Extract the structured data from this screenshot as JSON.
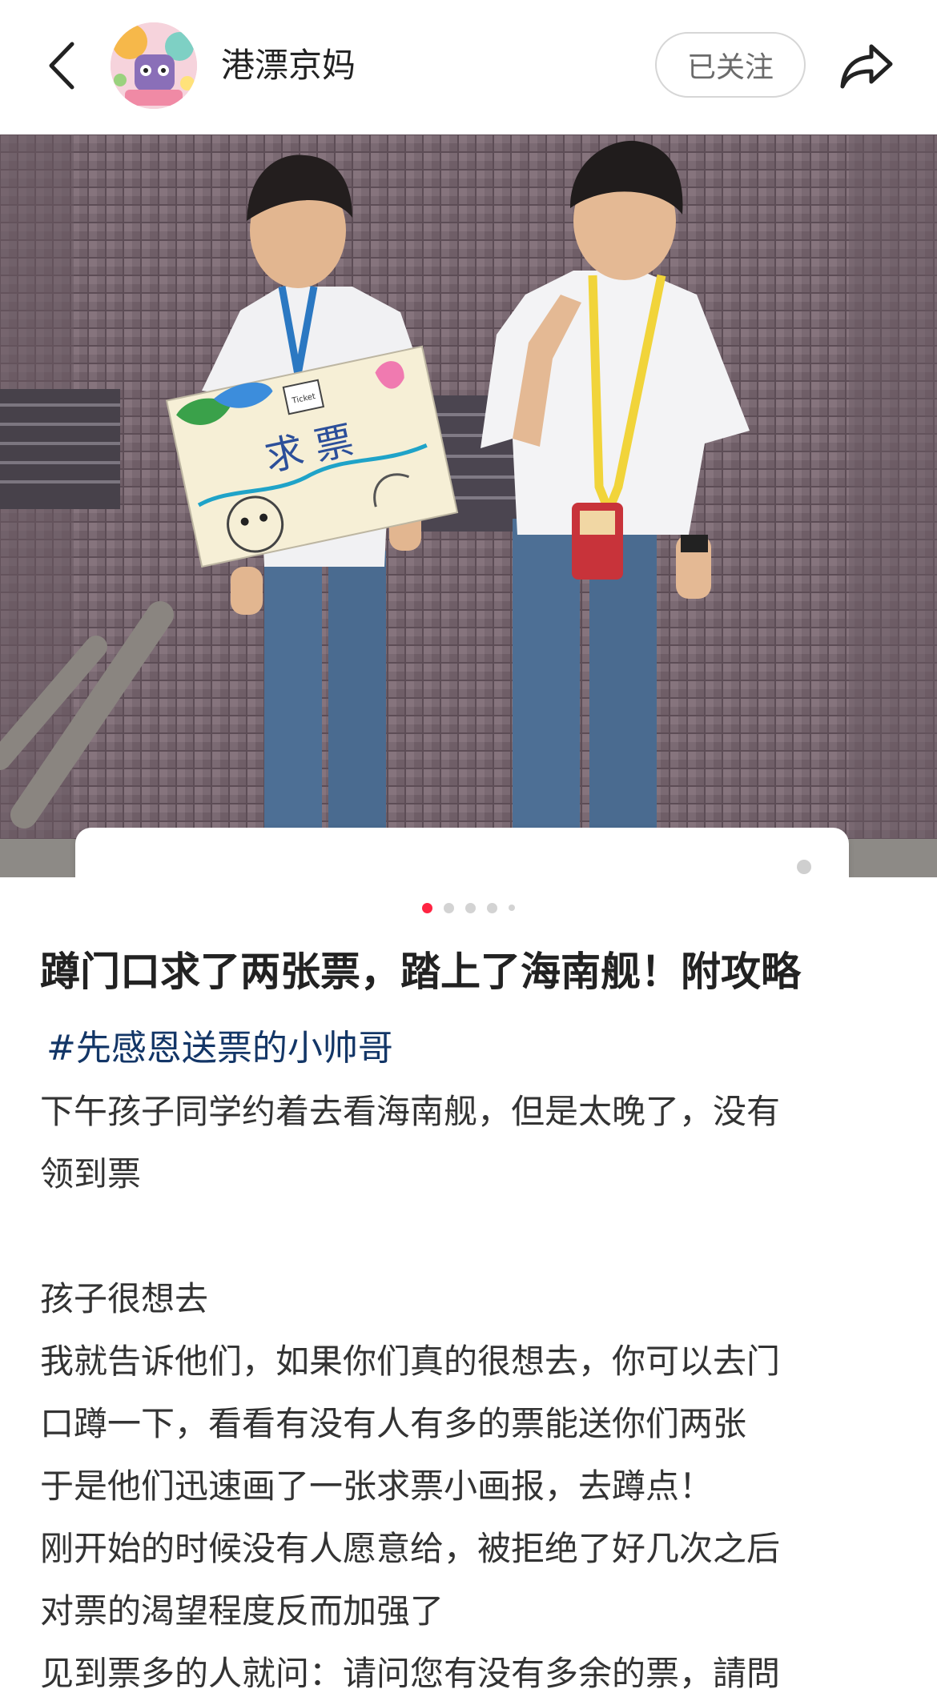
{
  "header": {
    "username": "港漂京妈",
    "follow_label": "已关注"
  },
  "pager": {
    "total": 5,
    "active_index": 0
  },
  "post": {
    "title": "蹲门口求了两张票，踏上了海南舰！附攻略",
    "hashtag": "#先感恩送票的小帅哥",
    "lines": [
      "下午孩子同学约着去看海南舰，但是太晚了，没有",
      "领到票",
      "",
      "孩子很想去",
      "我就告诉他们，如果你们真的很想去，你可以去门",
      "口蹲一下，看看有没有人有多的票能送你们两张",
      "于是他们迅速画了一张求票小画报，去蹲点！",
      "刚开始的时候没有人愿意给，被拒绝了好几次之后",
      "对票的渴望程度反而加强了",
      "见到票多的人就问：请问您有没有多余的票，請問"
    ]
  },
  "photo": {
    "sign_text": "求票",
    "sign_tag": "Ticket"
  },
  "colors": {
    "accent": "#ff2442",
    "hashtag": "#133667",
    "text": "#333333"
  },
  "icons": {
    "back": "chevron-left-icon",
    "share": "share-arrow-icon",
    "more": "vertical-dots-icon"
  }
}
